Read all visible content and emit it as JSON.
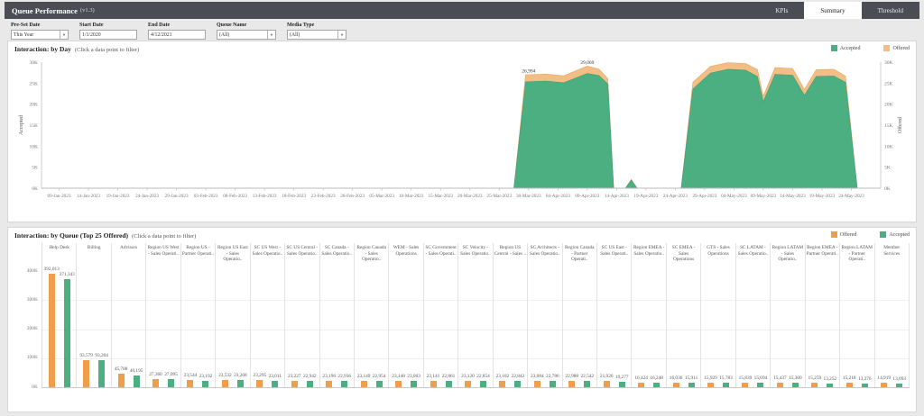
{
  "header": {
    "title": "Queue Performance",
    "version": "(v1.3)",
    "tabs": [
      {
        "label": "KPIs",
        "active": false
      },
      {
        "label": "Summary",
        "active": true
      },
      {
        "label": "Threshold",
        "active": false
      }
    ]
  },
  "filters": [
    {
      "label": "Pre-Set Date",
      "value": "This Year",
      "type": "select"
    },
    {
      "label": "Start Date",
      "value": "1/1/2020",
      "type": "text"
    },
    {
      "label": "End Date",
      "value": "4/12/2021",
      "type": "text"
    },
    {
      "label": "Queue Name",
      "value": "(All)",
      "type": "select"
    },
    {
      "label": "Media Type",
      "value": "(All)",
      "type": "select"
    }
  ],
  "colors": {
    "accepted_green": "#4CAF82",
    "offered_orange": "#F09E4B",
    "offered_area_band": "#F2BE85",
    "topbar_gray": "#4A4E54"
  },
  "panels": {
    "day": {
      "title": "Interaction: by Day",
      "note": "(Click a data point to filter)",
      "legend": [
        {
          "label": "Accepted",
          "color": "#4CAF82"
        },
        {
          "label": "Offered",
          "color": "#F2BE85"
        }
      ]
    },
    "queue": {
      "title": "Interaction: by Queue (Top 25 Offered)",
      "note": "(Click a data point to filter)",
      "legend": [
        {
          "label": "Offered",
          "color": "#F09E4B"
        },
        {
          "label": "Accepted",
          "color": "#4CAF82"
        }
      ]
    }
  },
  "chart_data": [
    {
      "type": "area",
      "title": "Interaction: by Day",
      "left_axis_label": "Accepted",
      "right_axis_label": "Offered",
      "ylim": [
        0,
        30000
      ],
      "y_ticks": [
        "0K",
        "5K",
        "10K",
        "15K",
        "20K",
        "25K",
        "30K"
      ],
      "x_tick_labels": [
        "09-Jan-2023",
        "14-Jan-2023",
        "19-Jan-2023",
        "24-Jan-2023",
        "29-Jan-2023",
        "03-Feb-2023",
        "08-Feb-2023",
        "13-Feb-2023",
        "18-Feb-2023",
        "23-Feb-2023",
        "28-Feb-2023",
        "05-Mar-2023",
        "10-Mar-2023",
        "15-Mar-2023",
        "20-Mar-2023",
        "25-Mar-2023",
        "30-Mar-2023",
        "04-Apr-2023",
        "09-Apr-2023",
        "14-Apr-2023",
        "19-Apr-2023",
        "24-Apr-2023",
        "29-Apr-2023",
        "04-May-2023",
        "09-May-2023",
        "14-May-2023",
        "19-May-2023",
        "24-May-2023"
      ],
      "x_tick_interval_days": 5,
      "series_names": [
        "Accepted",
        "Offered"
      ],
      "points_day_accepted_offered": [
        [
          0,
          0,
          0
        ],
        [
          77.5,
          0,
          0
        ],
        [
          79.5,
          25300,
          26994
        ],
        [
          83,
          25500,
          27150
        ],
        [
          86,
          25100,
          26750
        ],
        [
          90,
          27300,
          29069
        ],
        [
          92,
          26800,
          28300
        ],
        [
          93.5,
          24800,
          26100
        ],
        [
          94.5,
          0,
          0
        ],
        [
          96.5,
          0,
          0
        ],
        [
          97.5,
          1900,
          2150
        ],
        [
          98.5,
          0,
          0
        ],
        [
          106,
          0,
          0
        ],
        [
          108,
          23600,
          25200
        ],
        [
          111,
          27400,
          29000
        ],
        [
          114,
          28300,
          29900
        ],
        [
          117,
          28100,
          29650
        ],
        [
          119,
          26600,
          28250
        ],
        [
          120,
          20600,
          21900
        ],
        [
          122,
          27100,
          28700
        ],
        [
          125,
          26900,
          28500
        ],
        [
          127,
          22100,
          23500
        ],
        [
          129,
          26600,
          28200
        ],
        [
          132,
          26700,
          28300
        ],
        [
          134,
          25200,
          26700
        ],
        [
          136,
          0,
          0
        ],
        [
          140,
          0,
          0
        ]
      ],
      "annotations": [
        {
          "day": 80,
          "value": 29069,
          "label": "26,994",
          "at_value": 26994
        },
        {
          "day": 90,
          "value": 29069,
          "label": "29,069",
          "at_value": 29069
        }
      ],
      "legend": [
        "Accepted",
        "Offered"
      ]
    },
    {
      "type": "bar",
      "title": "Interaction: by Queue (Top 25 Offered)",
      "ylim": [
        0,
        400000
      ],
      "y_ticks": [
        "400K",
        "300K",
        "200K",
        "100K",
        "0K"
      ],
      "legend": [
        "Offered",
        "Accepted"
      ],
      "categories": [
        "Help Desk",
        "Billing",
        "Advisors",
        "Region US West - Sales Operati..",
        "Region US - Partner Operati..",
        "Region US East - Sales Operatio..",
        "SC US West - Sales Operatio..",
        "SC US Central - Sales Operatio..",
        "SC Canada - Sales Operatio..",
        "Region Canada - Sales Operatio..",
        "WEM - Sales Operations",
        "SC Government - Sales Operati..",
        "SC Velocity - Sales Operatio..",
        "Region US Central - Sales ..",
        "SC Architects - Sales Operatio..",
        "Region Canada - Partner Operati..",
        "SC US East - Sales Operati..",
        "Region EMEA - Sales Operatio..",
        "SC EMEA - Sales Operations",
        "GTS - Sales Operations",
        "SC LATAM - Sales Operatio..",
        "Region LATAM - Sales Operatio..",
        "Region EMEA - Partner Operati..",
        "Region LATAM - Partner Operati..",
        "Member Services"
      ],
      "series": [
        {
          "name": "Offered",
          "values": [
            392013,
            93579,
            45788,
            27360,
            23544,
            23532,
            23295,
            23227,
            23196,
            23149,
            23148,
            23141,
            23120,
            23102,
            23084,
            22988,
            21926,
            16424,
            16036,
            15929,
            15839,
            15437,
            15259,
            15218,
            14919
          ]
        },
        {
          "name": "Accepted",
          "values": [
            371343,
            93204,
            40195,
            27095,
            23192,
            23268,
            23011,
            22942,
            22936,
            22954,
            23003,
            22861,
            22854,
            22842,
            22786,
            22542,
            19277,
            16248,
            15911,
            15783,
            15694,
            15300,
            13252,
            13276,
            13093
          ]
        }
      ]
    }
  ]
}
